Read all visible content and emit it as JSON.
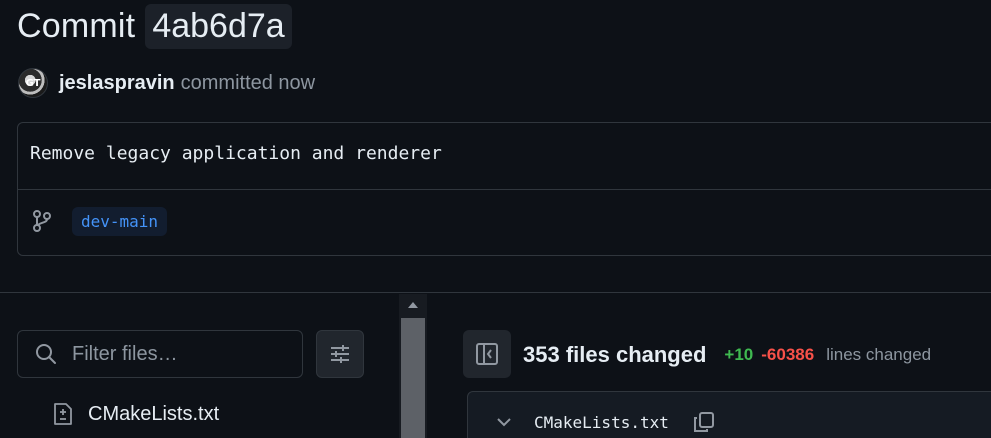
{
  "header": {
    "title_prefix": "Commit",
    "sha": "4ab6d7a"
  },
  "author": {
    "avatar_label": "GT",
    "name": "jeslaspravin",
    "action": "committed now"
  },
  "commit": {
    "message": "Remove legacy application and renderer",
    "branch": "dev-main"
  },
  "file_tree": {
    "filter_placeholder": "Filter files…",
    "items": [
      {
        "label": "CMakeLists.txt",
        "icon": "file-diff-icon"
      }
    ]
  },
  "diff_summary": {
    "files_changed": "353 files changed",
    "additions": "+10",
    "deletions": "-60386",
    "lines_changed": "lines changed"
  },
  "file_diff": {
    "file_name": "CMakeLists.txt"
  },
  "colors": {
    "background": "#0d1117",
    "border": "#30363d",
    "additions": "#3fb950",
    "deletions": "#f85149",
    "branch": "#4493f8"
  }
}
